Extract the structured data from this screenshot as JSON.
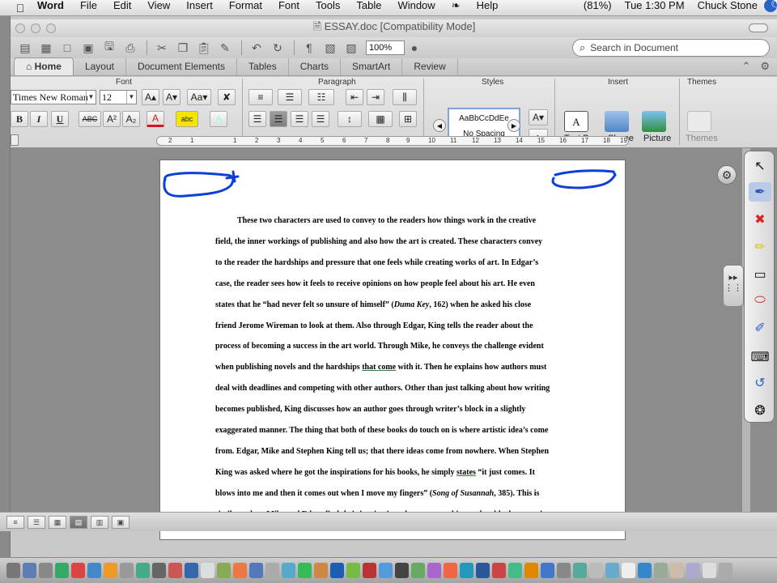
{
  "menubar": {
    "apple": "",
    "app": "Word",
    "items": [
      "File",
      "Edit",
      "View",
      "Insert",
      "Format",
      "Font",
      "Tools",
      "Table",
      "Window"
    ],
    "help": "Help",
    "battery": "(81%)",
    "clock": "Tue 1:30 PM",
    "user": "Chuck Stone"
  },
  "window": {
    "title": "ESSAY.doc [Compatibility Mode]",
    "zoom": "100%",
    "search_placeholder": "Search in Document"
  },
  "tabs": [
    "Home",
    "Layout",
    "Document Elements",
    "Tables",
    "Charts",
    "SmartArt",
    "Review"
  ],
  "ribbon": {
    "groups": [
      "Font",
      "Paragraph",
      "Styles",
      "Insert",
      "Themes"
    ],
    "font_name": "Times New Roman",
    "font_size": "12",
    "style_sample": "AaBbCcDdEe",
    "style_name": "No Spacing",
    "insert_items": [
      "Text Box",
      "Shape",
      "Picture"
    ],
    "themes_label": "Themes",
    "format_buttons": {
      "bold": "B",
      "italic": "I",
      "underline": "U",
      "strike": "ABC",
      "super": "A²",
      "sub": "A₂"
    }
  },
  "ruler": {
    "numbers": [
      "2",
      "1",
      "1",
      "2",
      "3",
      "4",
      "5",
      "6",
      "7",
      "8",
      "9",
      "10",
      "11",
      "12",
      "13",
      "14",
      "15",
      "16",
      "17",
      "18",
      "19"
    ]
  },
  "essay": {
    "lines": [
      {
        "text": "These two characters are used to convey to the readers how things work in the creative",
        "indent": true
      },
      {
        "text": "field, the inner workings of publishing and also how the art is created. These characters convey"
      },
      {
        "text": "to the reader the hardships and pressure that one feels while creating works of art. In Edgar’s"
      },
      {
        "text": "case, the reader sees how it feels to receive opinions on how people feel about his art. He even"
      },
      {
        "pre": "states that he “had never felt so unsure of himself” (",
        "ital": "Duma Key",
        "post": ", 162) when he asked his close"
      },
      {
        "text": "friend Jerome Wireman to look at them. Also through Edgar, King tells the reader about the"
      },
      {
        "text": "process of becoming a success in the art world. Through Mike, he conveys the challenge evident"
      },
      {
        "pre": "when publishing novels and the hardships ",
        "ul": "that come",
        "post": " with it. Then he explains how authors must"
      },
      {
        "text": "deal with deadlines and competing with other authors. Other than just talking about how writing"
      },
      {
        "text": "becomes published, King discusses how an author goes through writer’s block in a slightly"
      },
      {
        "text": "exaggerated manner. The thing that both of these books do touch on is where artistic idea’s come"
      },
      {
        "text": "from. Edgar, Mike and Stephen King tell us; that there ideas come from nowhere. When Stephen"
      },
      {
        "pre": "King was asked where he got the inspirations for his books, he simply ",
        "ul": "states",
        "post": " “it just comes. It"
      },
      {
        "pre": "blows into me and then it comes out when I move my fingers” (",
        "ital": "Song of Susannah",
        "post": ", 385). This is"
      },
      {
        "text": "similar to how Mike and Edgar find their inspiration; they see something and suddenly create it"
      }
    ]
  },
  "colors": {
    "ink": "#0b3fd8",
    "font_color_red": "#d21a1a",
    "highlight_yellow": "#f5e300",
    "style_border": "#7fa4d9"
  },
  "toolpal_icons": [
    "arrow-icon",
    "pen-icon",
    "marker-icon",
    "highlighter-icon",
    "eraser-icon",
    "shape-eraser-icon",
    "text-icon",
    "keyboard-icon",
    "undo-icon",
    "settings-icon"
  ]
}
